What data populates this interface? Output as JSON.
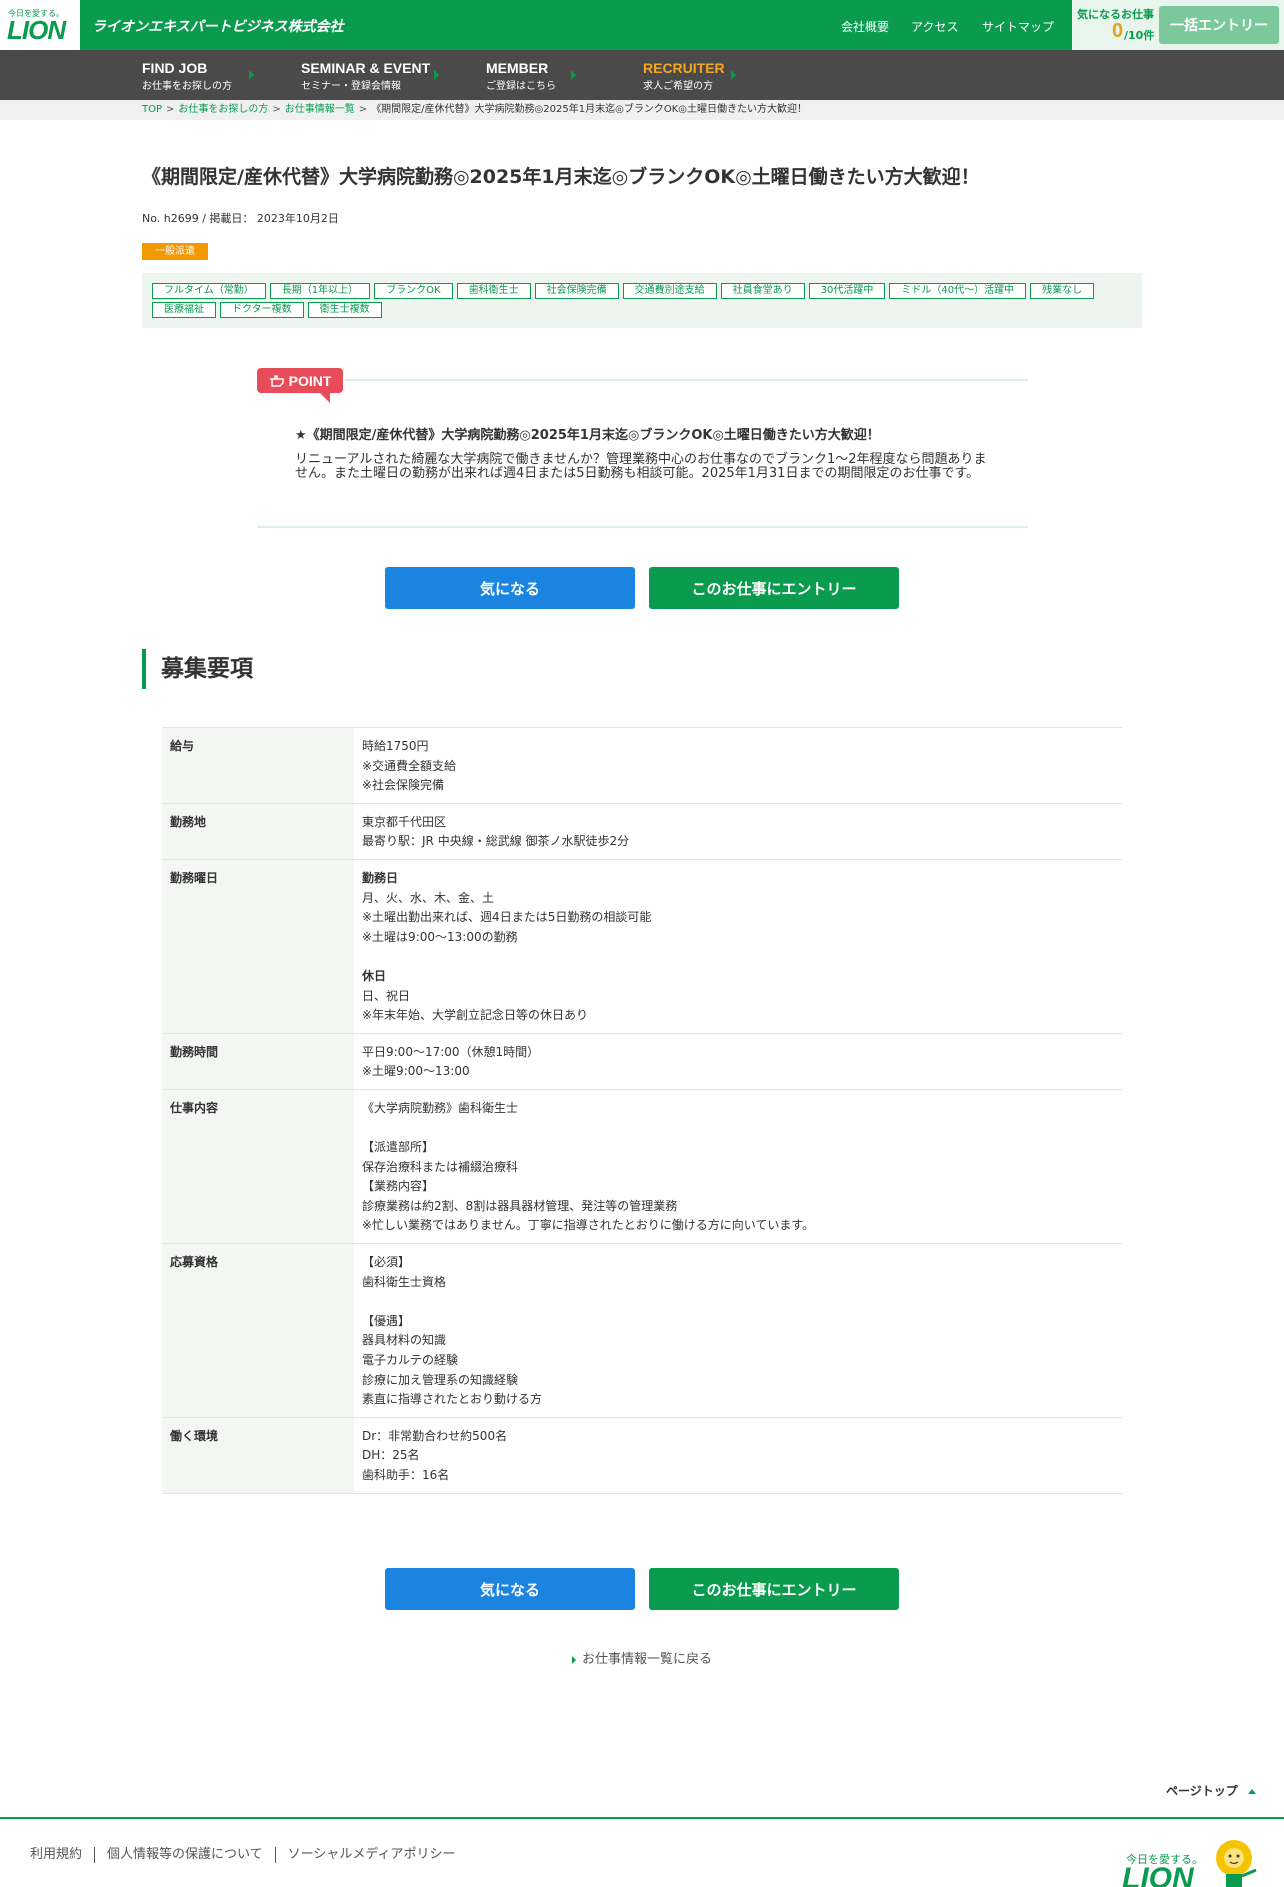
{
  "header": {
    "logo_tagline": "今日を愛する。",
    "logo_text": "LION",
    "company_name": "ライオンエキスパートビジネス株式会社",
    "links": [
      "会社概要",
      "アクセス",
      "サイトマップ"
    ],
    "favorites_label": "気になるお仕事",
    "favorites_count": "0",
    "favorites_max": "/10件",
    "bulk_entry_label": "一括エントリー"
  },
  "nav": [
    {
      "main": "FIND JOB",
      "sub": "お仕事をお探しの方"
    },
    {
      "main": "SEMINAR & EVENT",
      "sub": "セミナー・登録会情報"
    },
    {
      "main": "MEMBER",
      "sub": "ご登録はこちら"
    },
    {
      "main": "RECRUITER",
      "sub": "求人ご希望の方"
    }
  ],
  "breadcrumb": {
    "items": [
      "TOP",
      "お仕事をお探しの方",
      "お仕事情報一覧"
    ],
    "current": "《期間限定/産休代替》大学病院勤務◎2025年1月末迄◎ブランクOK◎土曜日働きたい方大歓迎！"
  },
  "job": {
    "title": "《期間限定/産休代替》大学病院勤務◎2025年1月末迄◎ブランクOK◎土曜日働きたい方大歓迎！",
    "meta": "No. h2699 / 掲載日： 2023年10月2日",
    "type": "一般派遣",
    "tags": [
      "フルタイム（常勤）",
      "長期（1年以上）",
      "ブランクOK",
      "歯科衛生士",
      "社会保険完備",
      "交通費別途支給",
      "社員食堂あり",
      "30代活躍中",
      "ミドル（40代〜）活躍中",
      "残業なし",
      "医療福祉",
      "ドクター複数",
      "衛生士複数"
    ]
  },
  "point": {
    "badge": "POINT",
    "headline": "★《期間限定/産休代替》大学病院勤務◎2025年1月末迄◎ブランクOK◎土曜日働きたい方大歓迎！",
    "body": "リニューアルされた綺麗な大学病院で働きませんか？管理業務中心のお仕事なのでブランク1〜2年程度なら問題ありません。また土曜日の勤務が出来れば週4日または5日勤務も相談可能。2025年1月31日までの期間限定のお仕事です。"
  },
  "buttons": {
    "favorite": "気になる",
    "entry": "このお仕事にエントリー"
  },
  "section_title": "募集要項",
  "requirements": [
    {
      "label": "給与",
      "lines": [
        "時給1750円",
        "※交通費全額支給",
        "※社会保険完備"
      ]
    },
    {
      "label": "勤務地",
      "lines": [
        "東京都千代田区",
        "最寄り駅：JR 中央線・総武線 御茶ノ水駅徒歩2分"
      ]
    },
    {
      "label": "勤務曜日",
      "lines": [
        "**勤務日",
        "月、火、水、木、金、土",
        "※土曜出勤出来れば、週4日または5日勤務の相談可能",
        "※土曜は9:00〜13:00の勤務",
        "",
        "**休日",
        "日、祝日",
        "※年末年始、大学創立記念日等の休日あり"
      ]
    },
    {
      "label": "勤務時間",
      "lines": [
        "平日9:00〜17:00（休憩1時間）",
        "※土曜9:00〜13:00"
      ]
    },
    {
      "label": "仕事内容",
      "lines": [
        "《大学病院勤務》歯科衛生士",
        "",
        "【派遣部所】",
        "保存治療科または補綴治療科",
        "【業務内容】",
        "診療業務は約2割、8割は器具器材管理、発注等の管理業務",
        "※忙しい業務ではありません。丁寧に指導されたとおりに働ける方に向いています。"
      ]
    },
    {
      "label": "応募資格",
      "lines": [
        "【必須】",
        "歯科衛生士資格",
        "",
        "【優遇】",
        "器具材料の知識",
        "電子カルテの経験",
        "診療に加え管理系の知識経験",
        "素直に指導されたとおり動ける方"
      ]
    },
    {
      "label": "働く環境",
      "lines": [
        "Dr：非常勤合わせ約500名",
        "DH：25名",
        "歯科助手：16名"
      ]
    }
  ],
  "back_link": "お仕事情報一覧に戻る",
  "page_top": "ページトップ",
  "footer": {
    "links": [
      "利用規約",
      "個人情報等の保護について",
      "ソーシャルメディアポリシー"
    ],
    "logo_tagline": "今日を愛する。",
    "logo_text": "LION"
  }
}
